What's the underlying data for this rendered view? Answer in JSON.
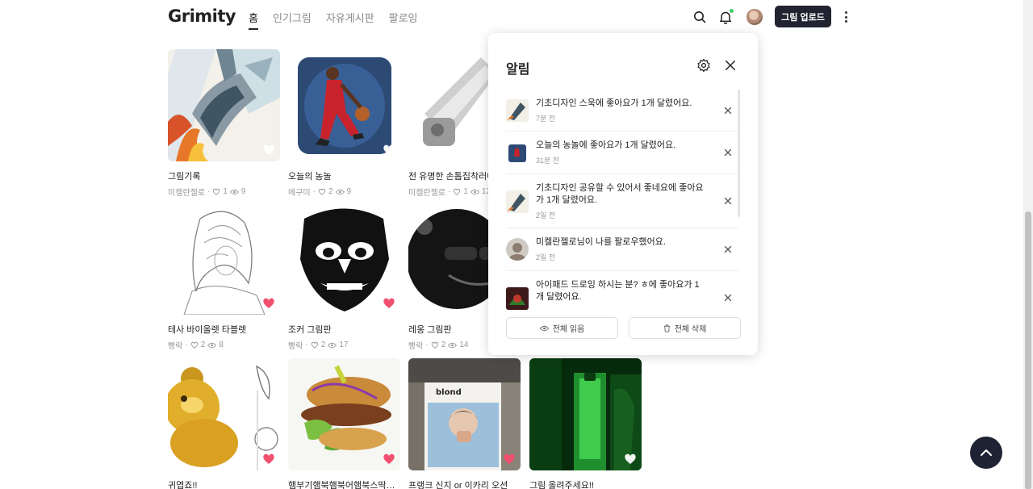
{
  "header": {
    "logo": "Grimity",
    "nav": [
      {
        "label": "홈",
        "active": true
      },
      {
        "label": "인기그림",
        "active": false
      },
      {
        "label": "자유게시판",
        "active": false
      },
      {
        "label": "팔로잉",
        "active": false
      }
    ],
    "upload_label": "그림 업로드",
    "icons": [
      "search-icon",
      "bell-icon",
      "avatar",
      "more-icon"
    ]
  },
  "cards": [
    {
      "title": "그림기록",
      "author": "미켈란젤로",
      "likes": "1",
      "views": "9",
      "liked": false,
      "art": "art1"
    },
    {
      "title": "오늘의 농놀",
      "author": "메구미",
      "likes": "2",
      "views": "9",
      "liked": false,
      "art": "art2"
    },
    {
      "title": "전 유명한 손톱집착러예요",
      "author": "미켈란젤로",
      "likes": "1",
      "views": "12",
      "liked": false,
      "art": "art3"
    },
    {
      "title": "테사 바이올렛 타블렛",
      "author": "빵락",
      "likes": "2",
      "views": "8",
      "liked": true,
      "art": "art4"
    },
    {
      "title": "조커 그림판",
      "author": "빵락",
      "likes": "2",
      "views": "17",
      "liked": true,
      "art": "art5"
    },
    {
      "title": "레옹 그림판",
      "author": "빵락",
      "likes": "2",
      "views": "14",
      "liked": true,
      "art": "art6"
    },
    {
      "title": "귀엽죠!!",
      "author": "",
      "likes": "",
      "views": "",
      "liked": true,
      "art": "art7"
    },
    {
      "title": "햄부기햄북햄북어햄북스딱스함...",
      "author": "",
      "likes": "",
      "views": "",
      "liked": true,
      "art": "art8"
    },
    {
      "title": "프랭크 신지 or 이카리 오션",
      "author": "",
      "likes": "",
      "views": "",
      "liked": true,
      "art": "art9"
    },
    {
      "title": "그림 올려주세요!!",
      "author": "",
      "likes": "",
      "views": "",
      "liked": false,
      "art": "art10"
    }
  ],
  "notifications": {
    "title": "알림",
    "items": [
      {
        "text": "기초디자인 스욱에 좋아요가 1개 달렸어요.",
        "time": "7분 전"
      },
      {
        "text": "오늘의 농놀에 좋아요가 1개 달렸어요.",
        "time": "31분 전"
      },
      {
        "text": "기초디자인 공유할 수 있어서 좋네요에 좋아요가 1개 달렸어요.",
        "time": "2일 전"
      },
      {
        "text": "미켈란젤로님이 나를 팔로우했어요.",
        "time": "2일 전"
      },
      {
        "text": "아이패드 드로잉 하시는 분? ㅎ에 좋아요가 1개 달렸어요.",
        "time": ""
      }
    ],
    "read_all_label": "전체 읽음",
    "delete_all_label": "전체 삭제"
  },
  "colors": {
    "upload_bg": "#222330",
    "heart_liked": "#f0506e",
    "notif_dot": "#3ecf6a",
    "fab_bg": "#1f2233"
  }
}
